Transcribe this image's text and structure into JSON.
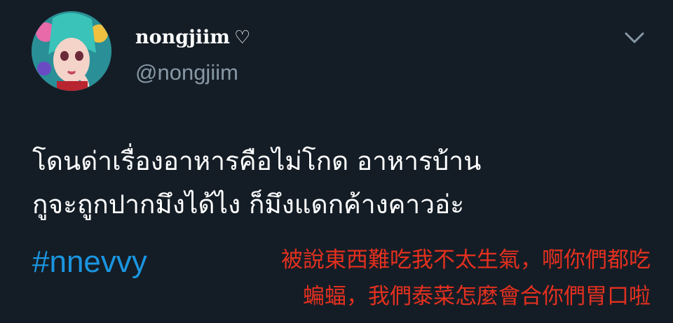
{
  "tweet": {
    "display_name": "nongjiim",
    "heart_glyph": "♡",
    "handle": "@nongjiim",
    "avatar_icon": "anime-girl-avatar-icon",
    "menu_icon": "chevron-down-icon",
    "text_lines": [
      "โดนด่าเรื่องอาหารคือไม่โกด อาหารบ้าน",
      "กูจะถูกปากมึงได้ไง ก็มึงแดกค้างคาวอ่ะ"
    ],
    "hashtag": "#nnevvy"
  },
  "translation": {
    "lines": [
      "被說東西難吃我不太生氣，啊你們都吃",
      "蝙蝠，我們泰菜怎麼會合你們胃口啦"
    ],
    "color": "#e3301f"
  },
  "colors": {
    "background": "#141d26",
    "handle": "#8899a6",
    "hashtag": "#1b95e0"
  }
}
